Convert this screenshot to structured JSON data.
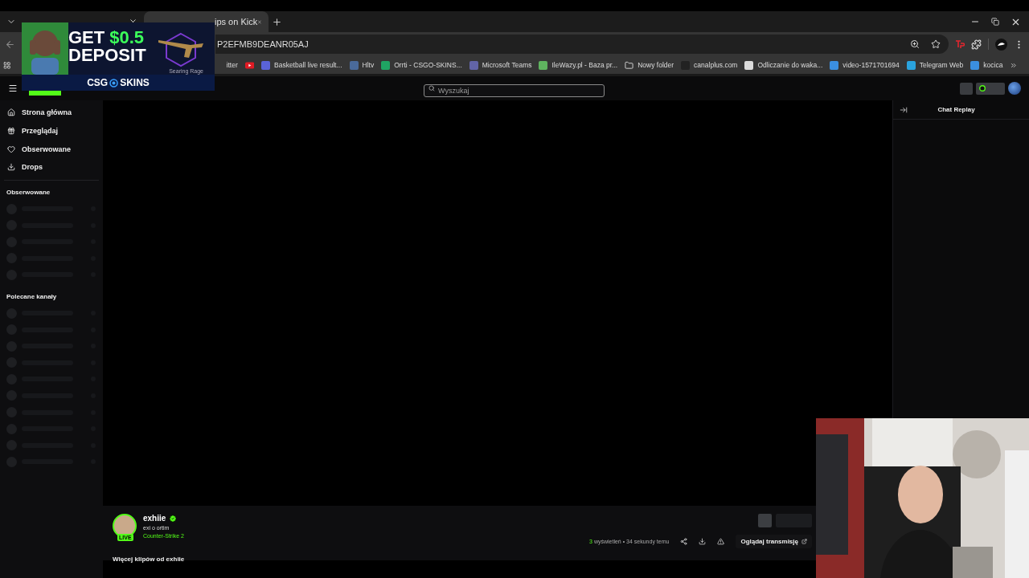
{
  "browser": {
    "tabs": [
      {
        "selected": false
      },
      {
        "title": "ips on Kick",
        "selected": true
      }
    ],
    "address": "P2EFMB9DEANR05AJ",
    "bookmarks": [
      "itter",
      "Basketball live result...",
      "Hltv",
      "Orrti - CSGO-SKINS...",
      "Microsoft Teams",
      "IleWazy.pl - Baza pr...",
      "Nowy folder",
      "canalplus.com",
      "Odliczanie do waka...",
      "video-1571701694",
      "Telegram Web",
      "kocica"
    ]
  },
  "ad": {
    "word_1": "GET",
    "amount": "$0.5",
    "word_2": "DEPOSIT",
    "item_name": "Searing Rage",
    "brand_left": "CSG",
    "brand_right": "SKINS"
  },
  "header": {
    "search": {
      "placeholder": "Wyszukaj"
    }
  },
  "sidebar": {
    "nav": [
      "Strona główna",
      "Przeglądaj",
      "Obserwowane",
      "Drops"
    ],
    "sections": [
      {
        "title": "Obserwowane",
        "items": [
          {
            "kind": "placeholder"
          },
          {
            "kind": "placeholder"
          },
          {
            "kind": "placeholder"
          },
          {
            "kind": "placeholder"
          },
          {
            "kind": "placeholder"
          }
        ]
      },
      {
        "title": "Polecane kanały",
        "items": [
          {
            "kind": "placeholder"
          },
          {
            "kind": "placeholder"
          },
          {
            "kind": "placeholder"
          },
          {
            "kind": "placeholder"
          },
          {
            "kind": "placeholder"
          },
          {
            "kind": "placeholder"
          },
          {
            "kind": "placeholder"
          },
          {
            "kind": "placeholder"
          },
          {
            "kind": "placeholder"
          },
          {
            "kind": "placeholder"
          }
        ]
      }
    ]
  },
  "chat": {
    "title": "Chat Replay"
  },
  "clip": {
    "channel": "exhiie",
    "verified": true,
    "live": true,
    "live_label": "LIVE",
    "title": "exi o ortim",
    "category": "Counter-Strike 2",
    "views": "3",
    "views_label": "wyświetleń",
    "separator": "•",
    "time": "34 sekundy temu",
    "watch_button": "Oglądaj transmisję",
    "more_clips": "Więcej klipów od exhiie"
  }
}
